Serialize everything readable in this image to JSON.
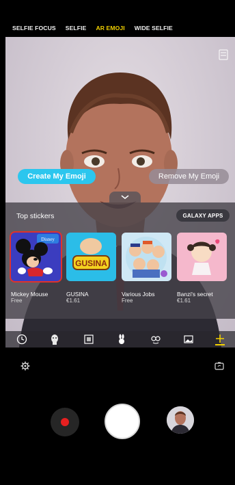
{
  "modes": [
    {
      "label": "SELFIE FOCUS",
      "active": false
    },
    {
      "label": "SELFIE",
      "active": false
    },
    {
      "label": "AR EMOJI",
      "active": true
    },
    {
      "label": "WIDE SELFIE",
      "active": false
    }
  ],
  "emoji_buttons": {
    "create": "Create My Emoji",
    "remove": "Remove My Emoji"
  },
  "stickers_panel": {
    "title": "Top stickers",
    "galaxy_apps": "GALAXY APPS",
    "items": [
      {
        "name": "Mickey Mouse",
        "price": "Free",
        "badge": "Disney",
        "selected": true
      },
      {
        "name": "GUSINA",
        "price": "€1.61",
        "art_text": "GUSINA"
      },
      {
        "name": "Various Jobs",
        "price": "Free"
      },
      {
        "name": "Banzi's secret",
        "price": "€1.61"
      }
    ]
  },
  "tool_tabs": [
    "clock-icon",
    "mask-icon",
    "frame-icon",
    "bunny-icon",
    "eyes-icon",
    "photo-icon",
    "plus-icon"
  ],
  "colors": {
    "active_mode": "#f3d100",
    "create_button": "#2cc6ee",
    "record_dot": "#e62020",
    "selected_outline": "#e0322a"
  }
}
